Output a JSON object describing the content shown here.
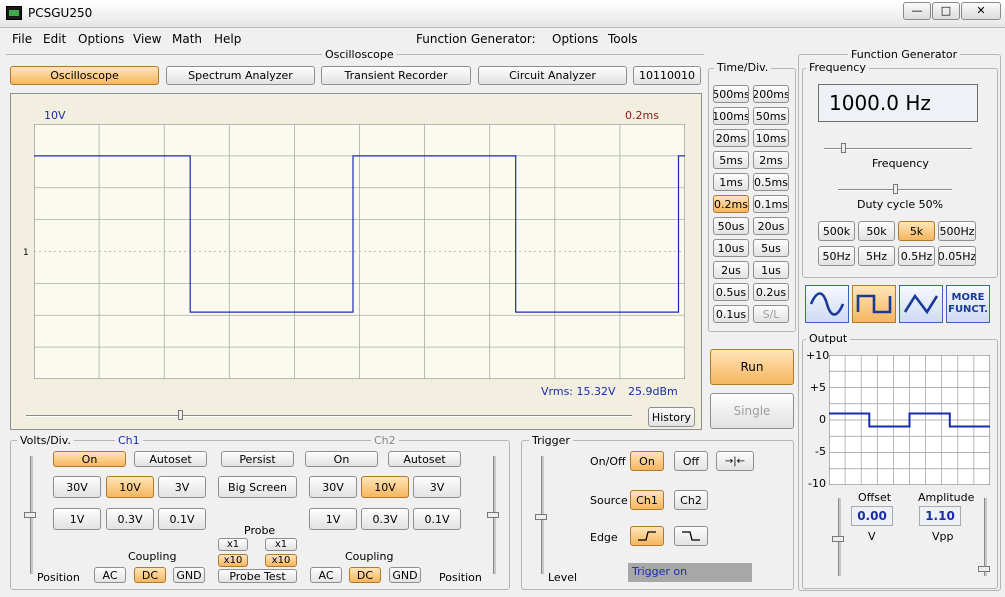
{
  "window": {
    "title": "PCSGU250",
    "minimize": "—",
    "maximize": "□",
    "close": "✕"
  },
  "menu": {
    "file": "File",
    "edit": "Edit",
    "options": "Options",
    "view": "View",
    "math": "Math",
    "help": "Help",
    "fg_label": "Function Generator:",
    "fg_options": "Options",
    "fg_tools": "Tools"
  },
  "osc": {
    "group": "Oscilloscope",
    "tabs": [
      "Oscilloscope",
      "Spectrum Analyzer",
      "Transient Recorder",
      "Circuit Analyzer",
      "10110010"
    ],
    "volt_label": "10V",
    "time_label": "0.2ms",
    "ch_marker": "1",
    "vrms": "Vrms: 15.32V",
    "dbm": "25.9dBm",
    "history": "History",
    "waveform": {
      "high_div": 3.0,
      "low_div": -1.9,
      "period_div": 5.0,
      "start_div": 9.9,
      "width_div": 10
    }
  },
  "timediv": {
    "label": "Time/Div.",
    "buttons": [
      "500ms",
      "200ms",
      "100ms",
      "50ms",
      "20ms",
      "10ms",
      "5ms",
      "2ms",
      "1ms",
      "0.5ms",
      "0.2ms",
      "0.1ms",
      "50us",
      "20us",
      "10us",
      "5us",
      "2us",
      "1us",
      "0.5us",
      "0.2us",
      "0.1us",
      "S/L"
    ],
    "selected": "0.2ms",
    "run": "Run",
    "single": "Single"
  },
  "volts": {
    "label": "Volts/Div.",
    "ch1": "Ch1",
    "ch2": "Ch2",
    "on": "On",
    "autoset": "Autoset",
    "persist": "Persist",
    "bigscreen": "Big Screen",
    "ranges_top": [
      "30V",
      "10V",
      "3V"
    ],
    "ranges_bot": [
      "1V",
      "0.3V",
      "0.1V"
    ],
    "ch1_selected": "10V",
    "ch2_selected": "10V",
    "probe": "Probe",
    "x1": "x1",
    "x10": "x10",
    "probetest": "Probe Test",
    "coupling": "Coupling",
    "ac": "AC",
    "dc": "DC",
    "gnd": "GND",
    "position": "Position"
  },
  "trigger": {
    "label": "Trigger",
    "onoff": "On/Off",
    "on": "On",
    "off": "Off",
    "source": "Source",
    "ch1": "Ch1",
    "ch2": "Ch2",
    "edge": "Edge",
    "level": "Level",
    "status": "Trigger on"
  },
  "fg": {
    "group": "Function Generator",
    "freq_label": "Frequency",
    "freq_value": "1000.0 Hz",
    "freq_slider_label": "Frequency",
    "duty": "Duty cycle 50%",
    "ranges": [
      "500k",
      "50k",
      "5k",
      "500Hz",
      "50Hz",
      "5Hz",
      "0.5Hz",
      "0.05Hz"
    ],
    "range_selected": "5k",
    "more": "MORE FUNCT.",
    "output": "Output",
    "yticks": [
      "+10",
      "+5",
      "0",
      "-5",
      "-10"
    ],
    "offset_label": "Offset",
    "offset_value": "0.00",
    "offset_unit": "V",
    "amp_label": "Amplitude",
    "amp_value": "1.10",
    "amp_unit": "Vpp",
    "output_wave": {
      "high": 0.4,
      "low": -0.4
    }
  },
  "colors": {
    "trace": "#1a2cab",
    "selected": "#f6b65f",
    "grid": "#a9a9a9"
  }
}
